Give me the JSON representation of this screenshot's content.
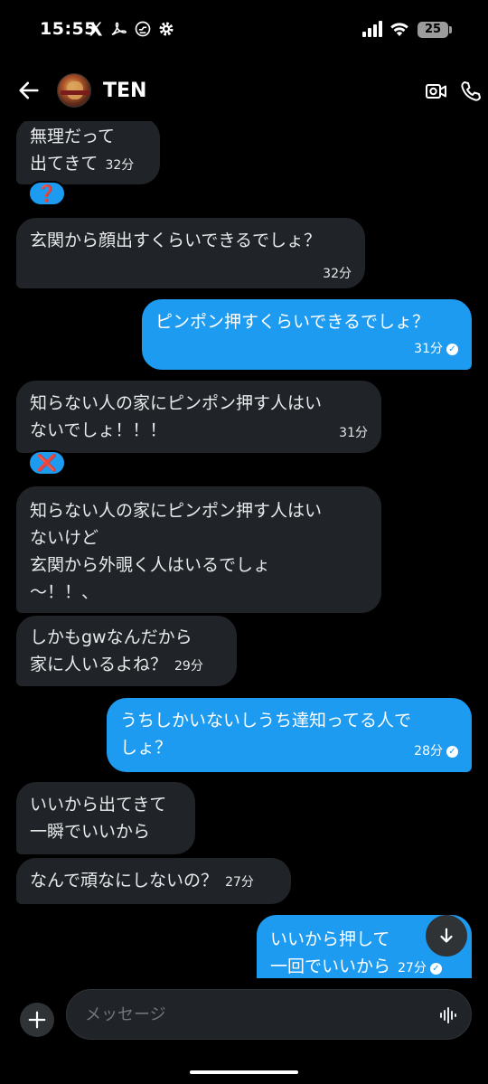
{
  "status_bar": {
    "time": "15:55",
    "battery": "25"
  },
  "header": {
    "contact_name": "TEN"
  },
  "messages": [
    {
      "lines": [
        "無理だって",
        "出てきて"
      ],
      "time": "32分"
    },
    {
      "lines": [
        "玄関から顔出すくらいできるでしょ？"
      ],
      "time": "32分"
    },
    {
      "lines": [
        "ピンポン押すくらいできるでしょ？"
      ],
      "time": "31分"
    },
    {
      "lines": [
        "知らない人の家にピンポン押す人はい",
        "ないでしょ！！！"
      ],
      "time": "31分"
    },
    {
      "lines": [
        "知らない人の家にピンポン押す人はい",
        "ないけど",
        "玄関から外覗く人はいるでしょ",
        "〜！！、"
      ]
    },
    {
      "lines": [
        "しかもgwなんだから",
        "家に人いるよね？"
      ],
      "time": "29分"
    },
    {
      "lines": [
        "うちしかいないしうち達知ってる人で",
        "しょ？"
      ],
      "time": "28分"
    },
    {
      "lines": [
        "いいから出てきて",
        "一瞬でいいから"
      ]
    },
    {
      "lines": [
        "なんで頑なにしないの？"
      ],
      "time": "27分"
    },
    {
      "lines": [
        "いいから押して",
        "一回でいいから"
      ],
      "time": "27分"
    }
  ],
  "reactions": {
    "first": "❓",
    "second": "❌"
  },
  "composer": {
    "placeholder": "メッセージ"
  },
  "colors": {
    "accent": "#1d9bf0",
    "incoming_bubble": "#202327",
    "background": "#000000"
  }
}
